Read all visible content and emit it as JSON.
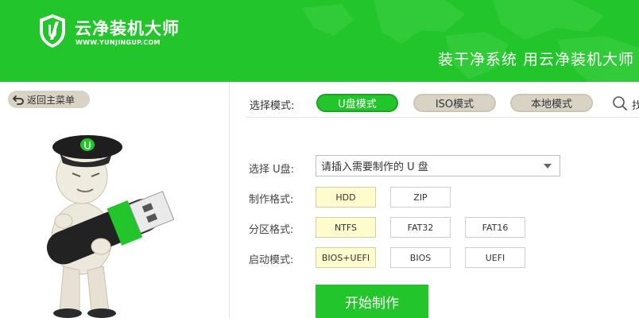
{
  "colors": {
    "brand_green": "#22c52a",
    "mode_inactive": "#d8d3c5",
    "option_selected": "#fefccd"
  },
  "header": {
    "app_name": "云净装机大师",
    "url": "WWW.YUNJINGUP.COM",
    "slogan": "装干净系统  用云净装机大师",
    "logo_icon": "shield-u-logo"
  },
  "left_panel": {
    "back_label": "返回主菜单",
    "back_icon": "return-arrow-icon",
    "mascot": "usb-mascot-illustration"
  },
  "modes": {
    "label": "选择模式:",
    "items": [
      "U盘模式",
      "ISO模式",
      "本地模式"
    ],
    "active": "U盘模式",
    "search_icon": "search-icon",
    "search_text_partial": "找"
  },
  "form": {
    "usb_label": "选择 U盘:",
    "usb_placeholder": "请插入需要制作的 U 盘",
    "format_label": "制作格式:",
    "format_options": [
      "HDD",
      "ZIP"
    ],
    "format_selected": "HDD",
    "partition_label": "分区格式:",
    "partition_options": [
      "NTFS",
      "FAT32",
      "FAT16"
    ],
    "partition_selected": "NTFS",
    "boot_label": "启动模式:",
    "boot_options": [
      "BIOS+UEFI",
      "BIOS",
      "UEFI"
    ],
    "boot_selected": "BIOS+UEFI"
  },
  "start_button": "开始制作"
}
